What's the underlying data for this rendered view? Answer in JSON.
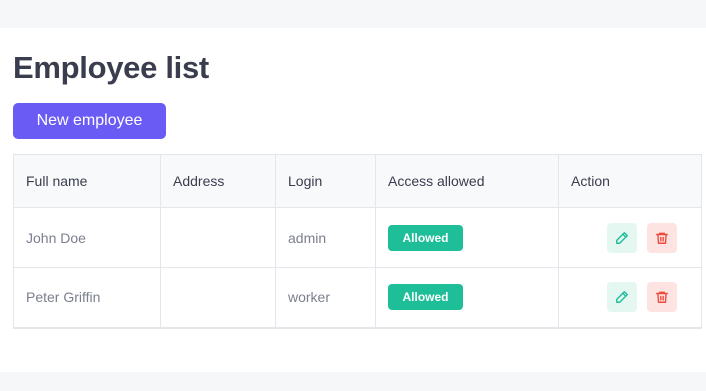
{
  "page": {
    "title": "Employee list",
    "new_button_label": "New employee"
  },
  "table": {
    "headers": [
      "Full name",
      "Address",
      "Login",
      "Access allowed",
      "Action"
    ],
    "rows": [
      {
        "full_name": "John Doe",
        "address": "",
        "login": "admin",
        "access": "Allowed"
      },
      {
        "full_name": "Peter Griffin",
        "address": "",
        "login": "worker",
        "access": "Allowed"
      }
    ]
  },
  "icons": {
    "edit": "pencil-icon",
    "delete": "trash-icon"
  },
  "colors": {
    "primary": "#6b5bf5",
    "allowed_badge": "#1ebe99",
    "edit_icon": "#1ebe99",
    "delete_icon": "#ef4a3c",
    "title_text": "#3a3d4d"
  }
}
